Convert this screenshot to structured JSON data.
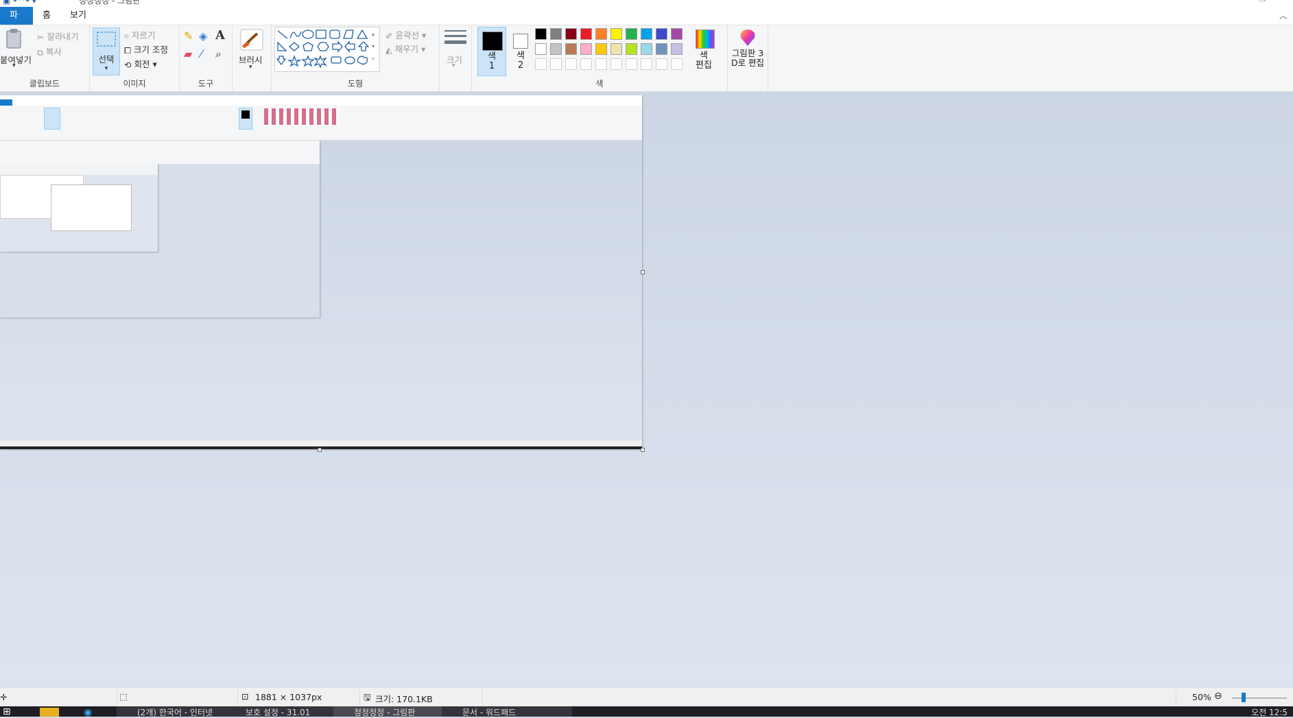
{
  "window": {
    "title": "정정정정 - 그림판"
  },
  "tabs": {
    "file": "파일",
    "home": "홈",
    "view": "보기"
  },
  "clipboard": {
    "paste": "붙여넣기",
    "cut": "잘라내기",
    "copy": "복사",
    "label": "클립보드"
  },
  "image": {
    "select": "선택",
    "crop": "자르기",
    "resize": "크기 조정",
    "rotate": "회전",
    "label": "이미지"
  },
  "tools": {
    "label": "도구"
  },
  "brushes": {
    "label": "브러시"
  },
  "shapes": {
    "outline": "윤곽선",
    "fill": "채우기",
    "label": "도형"
  },
  "size": {
    "label": "크기"
  },
  "colors": {
    "color1": "색\n1",
    "color1_a": "색",
    "color1_b": "1",
    "color2_a": "색",
    "color2_b": "2",
    "edit_a": "색",
    "edit_b": "편집",
    "label": "색",
    "row1": [
      "#000000",
      "#7f7f7f",
      "#880015",
      "#ed1c24",
      "#ff7f27",
      "#fff200",
      "#22b14c",
      "#00a2e8",
      "#3f48cc",
      "#a349a4"
    ],
    "row2": [
      "#ffffff",
      "#c3c3c3",
      "#b97a57",
      "#ffaec9",
      "#ffc90e",
      "#efe4b0",
      "#b5e61d",
      "#99d9ea",
      "#7092be",
      "#c8bfe7"
    ]
  },
  "paint3d": {
    "line1": "그림판 3",
    "line2": "D로 편집"
  },
  "status": {
    "dimensions": "1881 × 1037px",
    "size": "크기: 170.1KB",
    "zoom": "50%"
  },
  "taskbar": {
    "items": [
      "(2개) 한국어 - 인터넷",
      "보호 설정 - 31.01",
      "정정정정 - 그림판",
      "문서 - 워드패드"
    ],
    "clock": "오전 12:5"
  }
}
